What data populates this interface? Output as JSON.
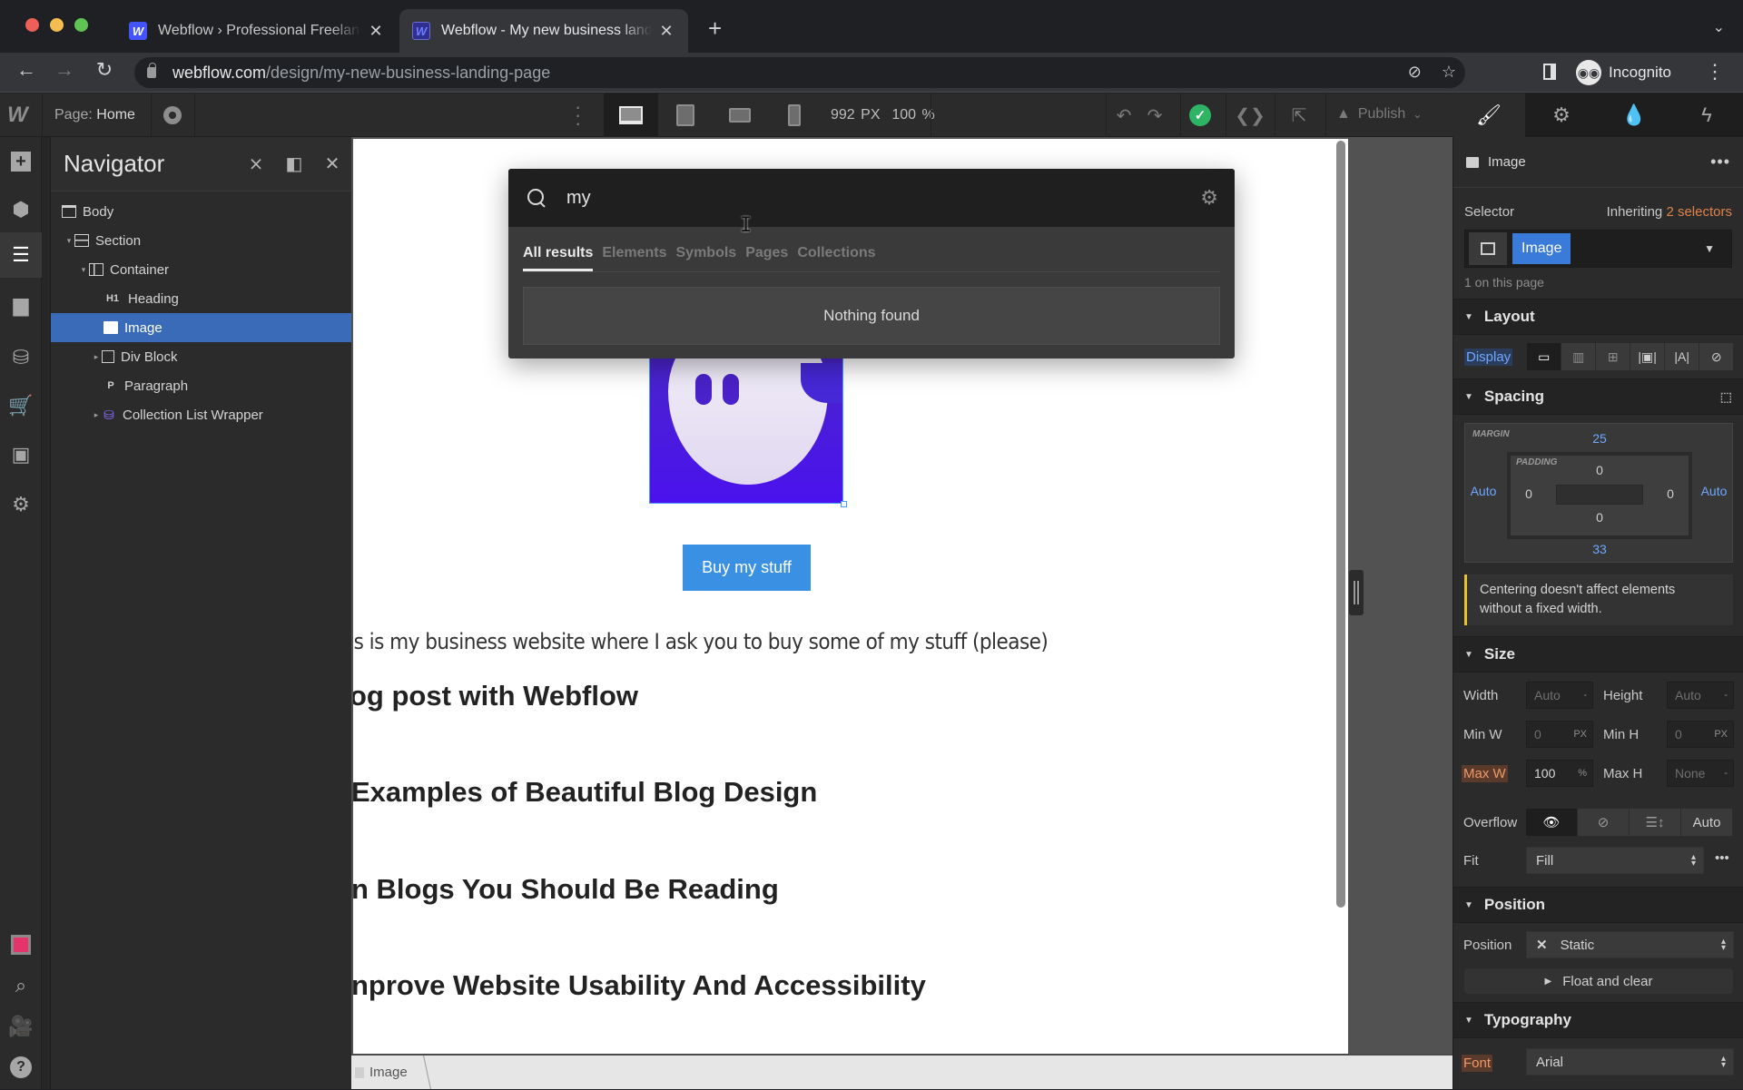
{
  "browser": {
    "tabs": [
      {
        "title": "Webflow › Professional Freelancer",
        "favicon": "W",
        "active": false
      },
      {
        "title": "Webflow - My new business landing page",
        "favicon": "W",
        "active": true
      }
    ],
    "new_tab_label": "+",
    "url_host": "webflow.com",
    "url_path": "/design/my-new-business-landing-page",
    "profile_label": "Incognito",
    "icons": {
      "back": "arrow-left-icon",
      "forward": "arrow-right-icon",
      "reload": "reload-icon",
      "eye_off": "eye-slash-icon",
      "star": "star-icon",
      "sidepanel": "side-panel-icon",
      "menu": "kebab-menu-icon"
    }
  },
  "designer": {
    "logo": "W",
    "page_prefix": "Page:",
    "page_name": "Home",
    "canvas_width": "992 PX",
    "zoom": "100 %",
    "publish_label": "Publish",
    "breakpoints": [
      "desktop",
      "tablet",
      "mobile-landscape",
      "mobile-portrait"
    ],
    "active_breakpoint": "desktop",
    "panel_tabs": [
      "style",
      "settings",
      "interactions",
      "lightning"
    ],
    "active_panel_tab": "style"
  },
  "rail": {
    "items": [
      "add",
      "symbols",
      "navigator",
      "pages",
      "cms",
      "ecommerce",
      "assets",
      "settings"
    ],
    "active": "navigator",
    "bottom_items": [
      "record",
      "search",
      "video-tutorials",
      "help"
    ]
  },
  "navigator": {
    "title": "Navigator",
    "tree": [
      {
        "label": "Body",
        "icon": "body",
        "depth": 0,
        "caret": ""
      },
      {
        "label": "Section",
        "icon": "section",
        "depth": 1,
        "caret": "▾"
      },
      {
        "label": "Container",
        "icon": "container",
        "depth": 2,
        "caret": "▾"
      },
      {
        "label": "Heading",
        "icon": "H1",
        "depth": 3,
        "caret": ""
      },
      {
        "label": "Image",
        "icon": "image",
        "depth": 3,
        "caret": "",
        "selected": true
      },
      {
        "label": "Div Block",
        "icon": "box",
        "depth": 3,
        "caret": "▸"
      },
      {
        "label": "Paragraph",
        "icon": "P",
        "depth": 3,
        "caret": ""
      },
      {
        "label": "Collection List Wrapper",
        "icon": "cms",
        "depth": 3,
        "caret": "▸"
      }
    ]
  },
  "search": {
    "query": "my",
    "tabs": [
      "All results",
      "Elements",
      "Symbols",
      "Pages",
      "Collections"
    ],
    "active_tab": "All results",
    "empty_message": "Nothing found"
  },
  "canvas": {
    "button_label": "Buy my stuff",
    "paragraph": "his is my business website where I ask you to buy some of my stuff (please)",
    "headings": [
      "og post with Webflow",
      " Examples of Beautiful Blog Design",
      "n Blogs You Should Be Reading",
      "nprove Website Usability And Accessibility"
    ],
    "breadcrumb": "Image"
  },
  "style_panel": {
    "element_name": "Image",
    "selector_label": "Selector",
    "inheriting_prefix": "Inheriting",
    "inheriting_count": "2 selectors",
    "selector_chip": "Image",
    "on_page": "1 on this page",
    "layout": {
      "title": "Layout",
      "display_label": "Display",
      "display_options": [
        "block",
        "flex",
        "grid",
        "inline-block",
        "inline",
        "none"
      ],
      "active": "block"
    },
    "spacing": {
      "title": "Spacing",
      "margin_label": "MARGIN",
      "padding_label": "PADDING",
      "margin": {
        "top": "25",
        "right": "Auto",
        "bottom": "33",
        "left": "Auto"
      },
      "padding": {
        "top": "0",
        "right": "0",
        "bottom": "0",
        "left": "0"
      },
      "notice": "Centering doesn't affect elements without a fixed width."
    },
    "size": {
      "title": "Size",
      "width_label": "Width",
      "width": "Auto",
      "width_unit": "-",
      "height_label": "Height",
      "height": "Auto",
      "height_unit": "-",
      "minw_label": "Min W",
      "minw": "0",
      "minw_unit": "PX",
      "minh_label": "Min H",
      "minh": "0",
      "minh_unit": "PX",
      "maxw_label": "Max W",
      "maxw": "100",
      "maxw_unit": "%",
      "maxh_label": "Max H",
      "maxh": "None",
      "maxh_unit": "-",
      "overflow_label": "Overflow",
      "overflow_options": [
        "visible",
        "hidden",
        "scroll",
        "Auto"
      ],
      "overflow_active": "visible",
      "fit_label": "Fit",
      "fit": "Fill"
    },
    "position": {
      "title": "Position",
      "label": "Position",
      "value": "Static",
      "float_label": "Float and clear"
    },
    "typography": {
      "title": "Typography",
      "font_label": "Font",
      "font": "Arial"
    }
  }
}
